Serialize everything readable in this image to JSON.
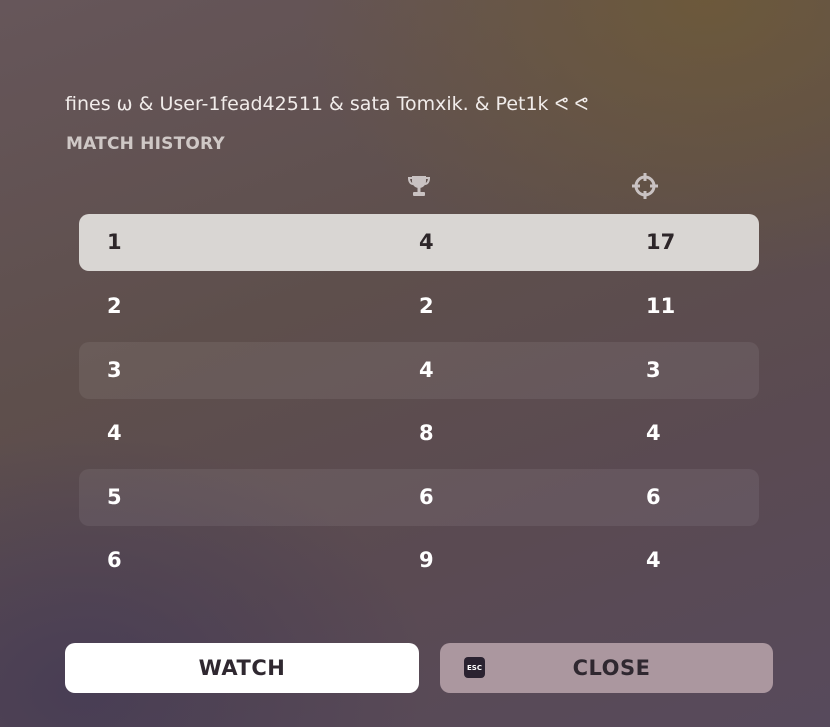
{
  "header": {
    "team_names": "fines ω & User-1fead42511 & sata Tomxik. & Pet1k ᕙ ᕙ",
    "section_title": "MATCH HISTORY"
  },
  "columns": {
    "placement_icon": "trophy-icon",
    "kills_icon": "crosshair-icon"
  },
  "matches": [
    {
      "match": "1",
      "placement": "4",
      "kills": "17",
      "selected": true
    },
    {
      "match": "2",
      "placement": "2",
      "kills": "11"
    },
    {
      "match": "3",
      "placement": "4",
      "kills": "3"
    },
    {
      "match": "4",
      "placement": "8",
      "kills": "4"
    },
    {
      "match": "5",
      "placement": "6",
      "kills": "6"
    },
    {
      "match": "6",
      "placement": "9",
      "kills": "4"
    }
  ],
  "buttons": {
    "watch_label": "WATCH",
    "close_label": "CLOSE",
    "esc_key_label": "ESC"
  },
  "colors": {
    "selected_row": "#d9d6d3",
    "watch_button": "#ffffff",
    "close_button": "#ab979f",
    "dark_text": "#2f2830"
  }
}
